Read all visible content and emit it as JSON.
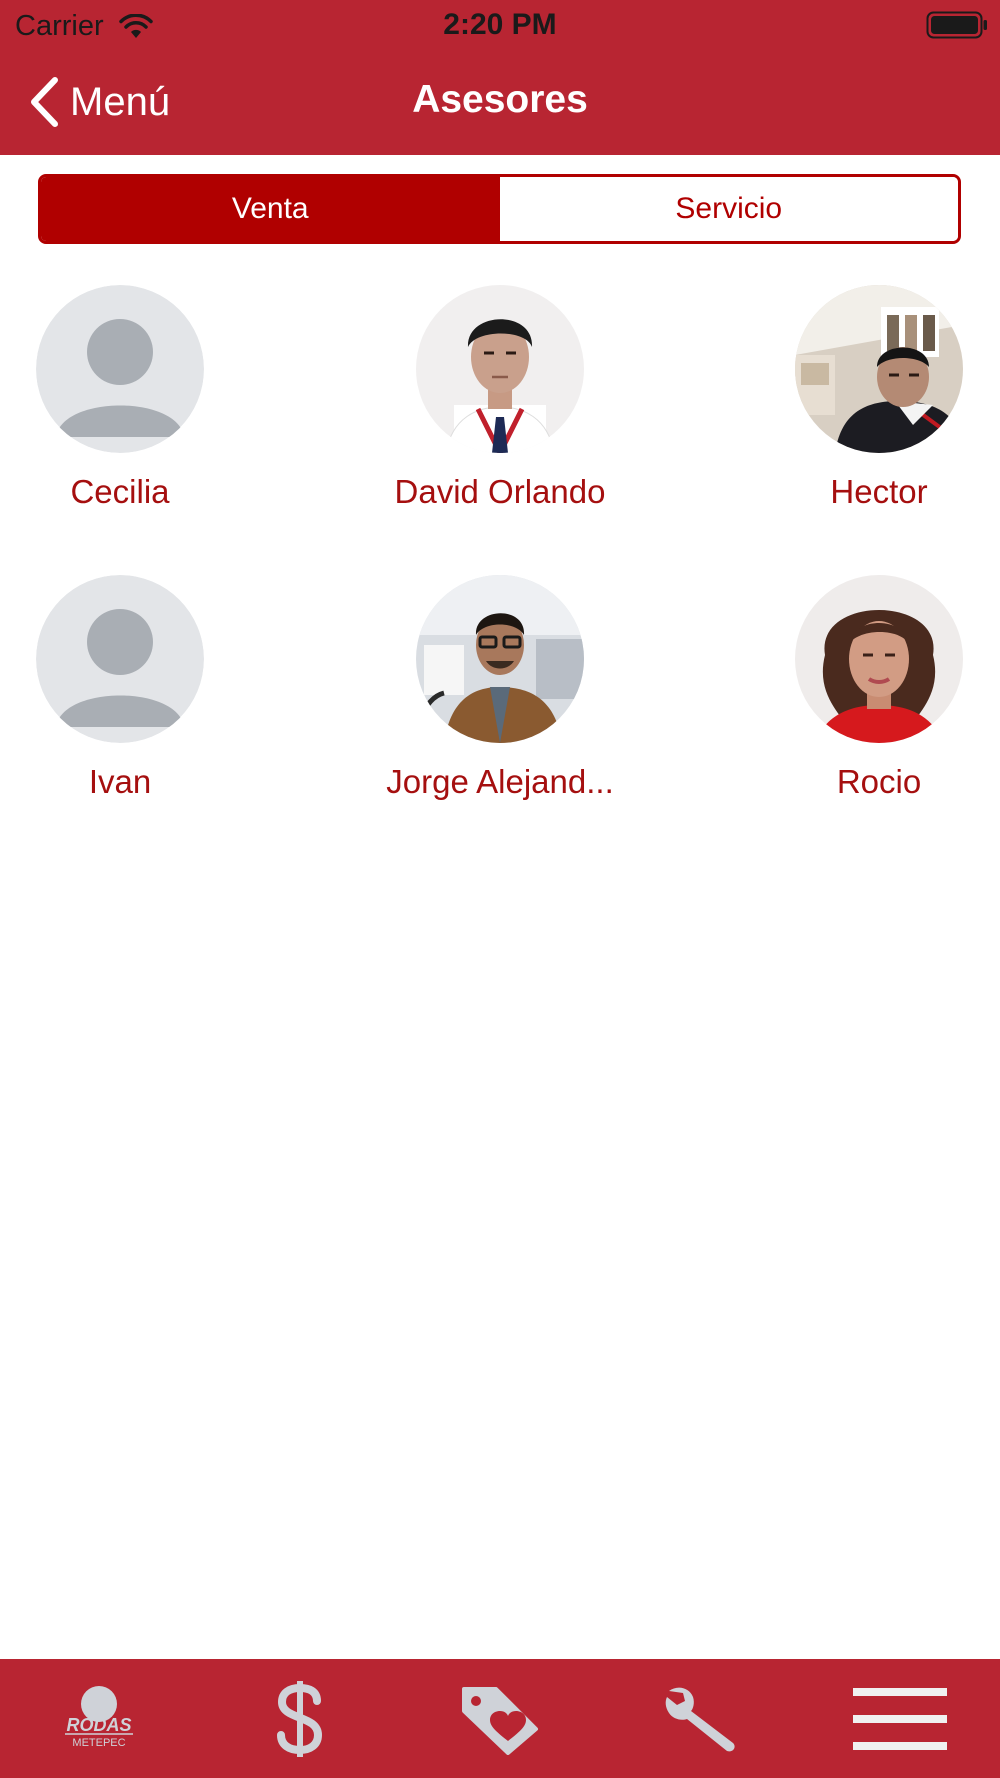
{
  "status_bar": {
    "carrier": "Carrier",
    "time": "2:20 PM"
  },
  "nav": {
    "back_label": "Menú",
    "title": "Asesores"
  },
  "segments": [
    {
      "label": "Venta",
      "active": true
    },
    {
      "label": "Servicio",
      "active": false
    }
  ],
  "advisors": [
    {
      "name": "Cecilia",
      "photo": "placeholder-avatar"
    },
    {
      "name": "David Orlando",
      "photo": "photo"
    },
    {
      "name": "Hector",
      "photo": "photo"
    },
    {
      "name": "Ivan",
      "photo": "placeholder-avatar"
    },
    {
      "name": "Jorge Alejand...",
      "photo": "photo"
    },
    {
      "name": "Rocio",
      "photo": "photo"
    }
  ],
  "tab_bar": {
    "logo_text": "RODAS",
    "logo_subtext": "METEPEC",
    "tabs": [
      "logo-icon",
      "dollar-icon",
      "tag-heart-icon",
      "wrench-icon",
      "menu-icon"
    ]
  },
  "colors": {
    "header_bg": "#b82532",
    "segment_active": "#b00000",
    "name_text": "#a50f0f",
    "tab_icon": "#cfd2d8"
  }
}
